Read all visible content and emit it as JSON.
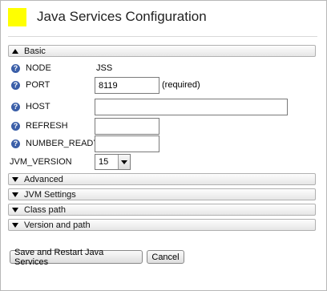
{
  "header": {
    "title": "Java Services Configuration",
    "logo_color": "#ffff00"
  },
  "sections": {
    "basic": "Basic",
    "advanced": "Advanced",
    "jvm_settings": "JVM Settings",
    "class_path": "Class path",
    "version_and_path": "Version and path"
  },
  "fields": {
    "node": {
      "label": "NODE",
      "value": "JSS"
    },
    "port": {
      "label": "PORT",
      "value": "8119",
      "note": "(required)"
    },
    "host": {
      "label": "HOST",
      "value": ""
    },
    "refresh": {
      "label": "REFRESH",
      "value": ""
    },
    "number_ready": {
      "label": "NUMBER_READY",
      "value": ""
    },
    "jvm_version": {
      "label": "JVM_VERSION",
      "selected": "15"
    }
  },
  "help_icon_glyph": "?",
  "buttons": {
    "save_restart": "Save and Restart Java Services",
    "cancel": "Cancel"
  }
}
